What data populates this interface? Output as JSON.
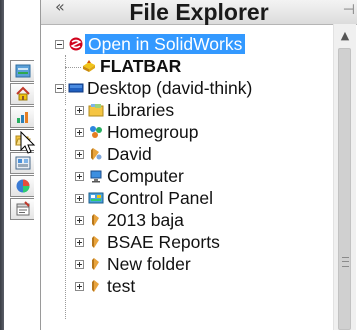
{
  "panel": {
    "title": "File Explorer",
    "collapse_glyph": "«",
    "pin_glyph": "⊣"
  },
  "task_pane_tabs": [
    {
      "name": "design-library-tab",
      "icon": "design-library-icon"
    },
    {
      "name": "home-tab",
      "icon": "house-icon"
    },
    {
      "name": "resources-tab",
      "icon": "resources-icon"
    },
    {
      "name": "file-explorer-tab",
      "icon": "open-folder-icon",
      "active": true
    },
    {
      "name": "view-palette-tab",
      "icon": "view-palette-icon"
    },
    {
      "name": "appearances-tab",
      "icon": "appearances-icon"
    },
    {
      "name": "custom-properties-tab",
      "icon": "custom-properties-icon"
    }
  ],
  "tree": {
    "open_in_solidworks": {
      "label": "Open in SolidWorks",
      "icon": "solidworks-icon",
      "expanded": true,
      "selected": true
    },
    "flatbar": {
      "label": "FLATBAR",
      "icon": "part-icon"
    },
    "desktop": {
      "label": "Desktop (david-think)",
      "icon": "desktop-icon",
      "expanded": true
    },
    "children": [
      {
        "label": "Libraries",
        "icon": "libraries-icon"
      },
      {
        "label": "Homegroup",
        "icon": "homegroup-icon"
      },
      {
        "label": "David",
        "icon": "user-folder-icon"
      },
      {
        "label": "Computer",
        "icon": "computer-icon"
      },
      {
        "label": "Control Panel",
        "icon": "control-panel-icon"
      },
      {
        "label": "2013 baja",
        "icon": "folder-icon"
      },
      {
        "label": "BSAE Reports",
        "icon": "folder-icon"
      },
      {
        "label": "New folder",
        "icon": "folder-icon"
      },
      {
        "label": "test",
        "icon": "folder-icon"
      }
    ]
  },
  "scrollbar": {
    "up_glyph": "▲"
  },
  "colors": {
    "selection": "#3399ff",
    "folder": "#e8a33c",
    "strip": "#3a3d45"
  }
}
